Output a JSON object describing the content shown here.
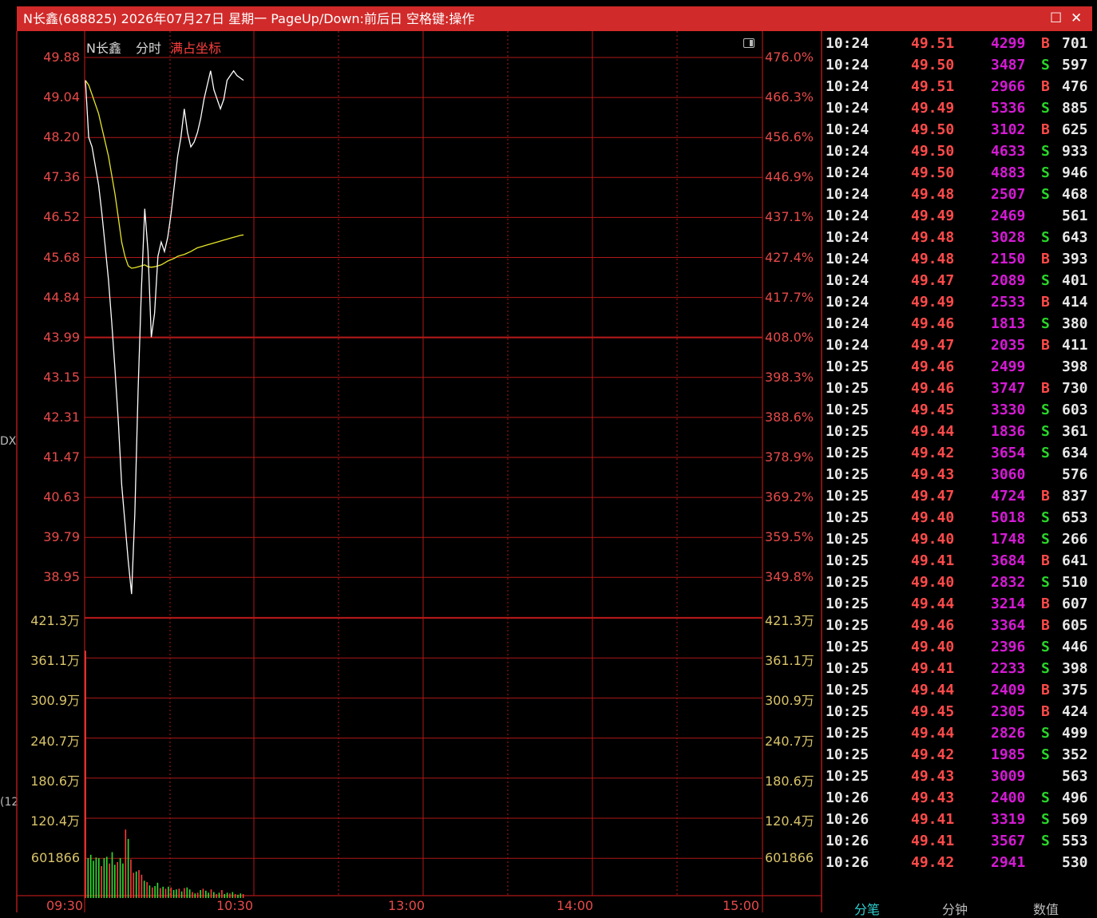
{
  "window": {
    "title": "N长鑫(688825) 2026年07月27日 星期一 PageUp/Down:前后日 空格键:操作",
    "maximize_glyph": "☐",
    "close_glyph": "✕"
  },
  "chart_header": {
    "stock_name": "N长鑫",
    "mode_label": "分时",
    "scale_label": "满占坐标"
  },
  "left_edge_labels": [
    "DX",
    "(12"
  ],
  "price_axis_left": [
    "49.88",
    "49.04",
    "48.20",
    "47.36",
    "46.52",
    "45.68",
    "44.84",
    "43.99",
    "43.15",
    "42.31",
    "41.47",
    "40.63",
    "39.79",
    "38.95"
  ],
  "pct_axis_right": [
    "476.0%",
    "466.3%",
    "456.6%",
    "446.9%",
    "437.1%",
    "427.4%",
    "417.7%",
    "408.0%",
    "398.3%",
    "388.6%",
    "378.9%",
    "369.2%",
    "359.5%",
    "349.8%"
  ],
  "volume_axis_left": [
    "421.3万",
    "361.1万",
    "300.9万",
    "240.7万",
    "180.6万",
    "120.4万",
    "601866"
  ],
  "volume_axis_right": [
    "421.3万",
    "361.1万",
    "300.9万",
    "240.7万",
    "180.6万",
    "120.4万",
    "601866"
  ],
  "time_axis": [
    "09:30",
    "10:30",
    "13:00",
    "14:00",
    "15:00"
  ],
  "colors": {
    "grid": "#b01818",
    "price_line": "#ffffff",
    "avg_line": "#e6e62a",
    "vol_up": "#ff3b3b",
    "vol_down": "#2ee02e",
    "title_bg": "#d12a2a"
  },
  "chart_data": {
    "type": "line",
    "ylim": [
      38.95,
      49.88
    ],
    "series": [
      {
        "values": [
          49.4,
          48.2,
          48.0,
          47.6,
          47.2,
          46.6,
          45.9,
          45.2,
          44.3,
          43.3,
          42.2,
          40.9,
          40.1,
          39.3,
          38.6,
          40.3,
          42.9,
          45.0,
          46.7,
          45.8,
          44.0,
          44.5,
          45.7,
          46.0,
          45.8,
          46.1,
          46.6,
          47.2,
          47.8,
          48.2,
          48.8,
          48.3,
          48.0,
          48.1,
          48.3,
          48.6,
          49.0,
          49.3,
          49.6,
          49.2,
          49.0,
          48.8,
          49.0,
          49.4,
          49.5,
          49.6,
          49.5,
          49.45,
          49.4
        ]
      },
      {
        "values": [
          49.4,
          49.3,
          49.1,
          48.9,
          48.7,
          48.4,
          48.1,
          47.8,
          47.4,
          47.0,
          46.5,
          46.0,
          45.7,
          45.5,
          45.45,
          45.46,
          45.48,
          45.5,
          45.52,
          45.48,
          45.47,
          45.48,
          45.5,
          45.52,
          45.56,
          45.6,
          45.63,
          45.66,
          45.7,
          45.72,
          45.74,
          45.77,
          45.8,
          45.84,
          45.88,
          45.9,
          45.92,
          45.94,
          45.96,
          45.98,
          46.0,
          46.02,
          46.04,
          46.06,
          46.08,
          46.1,
          46.12,
          46.14,
          46.15
        ]
      }
    ],
    "volume": {
      "ylim": [
        0,
        4213000
      ],
      "values": [
        3720000,
        600000,
        650000,
        560000,
        610000,
        600000,
        480000,
        600000,
        620000,
        520000,
        690000,
        500000,
        540000,
        600000,
        520000,
        1030000,
        890000,
        580000,
        380000,
        400000,
        420000,
        350000,
        260000,
        240000,
        190000,
        160000,
        180000,
        230000,
        150000,
        170000,
        140000,
        170000,
        160000,
        120000,
        130000,
        140000,
        100000,
        150000,
        160000,
        130000,
        90000,
        70000,
        80000,
        120000,
        140000,
        110000,
        80000,
        130000,
        90000,
        60000,
        80000,
        120000,
        60000,
        80000,
        70000,
        90000,
        60000,
        50000,
        70000,
        60000
      ],
      "up": [
        1,
        0,
        0,
        0,
        0,
        0,
        1,
        0,
        0,
        1,
        0,
        0,
        1,
        0,
        0,
        1,
        0,
        1,
        1,
        0,
        1,
        1,
        0,
        1,
        0,
        1,
        0,
        0,
        1,
        0,
        1,
        0,
        1,
        0,
        0,
        1,
        0,
        1,
        0,
        0,
        1,
        0,
        1,
        0,
        1,
        0,
        0,
        1,
        0,
        1,
        0,
        1,
        0,
        0,
        1,
        0,
        1,
        0,
        0,
        1
      ]
    }
  },
  "ticks": [
    {
      "time": "10:24",
      "price": "49.51",
      "vol": "4299",
      "side": "B",
      "count": "701"
    },
    {
      "time": "10:24",
      "price": "49.50",
      "vol": "3487",
      "side": "S",
      "count": "597"
    },
    {
      "time": "10:24",
      "price": "49.51",
      "vol": "2966",
      "side": "B",
      "count": "476"
    },
    {
      "time": "10:24",
      "price": "49.49",
      "vol": "5336",
      "side": "S",
      "count": "885"
    },
    {
      "time": "10:24",
      "price": "49.50",
      "vol": "3102",
      "side": "B",
      "count": "625"
    },
    {
      "time": "10:24",
      "price": "49.50",
      "vol": "4633",
      "side": "S",
      "count": "933"
    },
    {
      "time": "10:24",
      "price": "49.50",
      "vol": "4883",
      "side": "S",
      "count": "946"
    },
    {
      "time": "10:24",
      "price": "49.48",
      "vol": "2507",
      "side": "S",
      "count": "468"
    },
    {
      "time": "10:24",
      "price": "49.49",
      "vol": "2469",
      "side": "",
      "count": "561"
    },
    {
      "time": "10:24",
      "price": "49.48",
      "vol": "3028",
      "side": "S",
      "count": "643"
    },
    {
      "time": "10:24",
      "price": "49.48",
      "vol": "2150",
      "side": "B",
      "count": "393"
    },
    {
      "time": "10:24",
      "price": "49.47",
      "vol": "2089",
      "side": "S",
      "count": "401"
    },
    {
      "time": "10:24",
      "price": "49.49",
      "vol": "2533",
      "side": "B",
      "count": "414"
    },
    {
      "time": "10:24",
      "price": "49.46",
      "vol": "1813",
      "side": "S",
      "count": "380"
    },
    {
      "time": "10:24",
      "price": "49.47",
      "vol": "2035",
      "side": "B",
      "count": "411"
    },
    {
      "time": "10:25",
      "price": "49.46",
      "vol": "2499",
      "side": "",
      "count": "398"
    },
    {
      "time": "10:25",
      "price": "49.46",
      "vol": "3747",
      "side": "B",
      "count": "730"
    },
    {
      "time": "10:25",
      "price": "49.45",
      "vol": "3330",
      "side": "S",
      "count": "603"
    },
    {
      "time": "10:25",
      "price": "49.44",
      "vol": "1836",
      "side": "S",
      "count": "361"
    },
    {
      "time": "10:25",
      "price": "49.42",
      "vol": "3654",
      "side": "S",
      "count": "634"
    },
    {
      "time": "10:25",
      "price": "49.43",
      "vol": "3060",
      "side": "",
      "count": "576"
    },
    {
      "time": "10:25",
      "price": "49.47",
      "vol": "4724",
      "side": "B",
      "count": "837"
    },
    {
      "time": "10:25",
      "price": "49.40",
      "vol": "5018",
      "side": "S",
      "count": "653"
    },
    {
      "time": "10:25",
      "price": "49.40",
      "vol": "1748",
      "side": "S",
      "count": "266"
    },
    {
      "time": "10:25",
      "price": "49.41",
      "vol": "3684",
      "side": "B",
      "count": "641"
    },
    {
      "time": "10:25",
      "price": "49.40",
      "vol": "2832",
      "side": "S",
      "count": "510"
    },
    {
      "time": "10:25",
      "price": "49.44",
      "vol": "3214",
      "side": "B",
      "count": "607"
    },
    {
      "time": "10:25",
      "price": "49.46",
      "vol": "3364",
      "side": "B",
      "count": "605"
    },
    {
      "time": "10:25",
      "price": "49.40",
      "vol": "2396",
      "side": "S",
      "count": "446"
    },
    {
      "time": "10:25",
      "price": "49.41",
      "vol": "2233",
      "side": "S",
      "count": "398"
    },
    {
      "time": "10:25",
      "price": "49.44",
      "vol": "2409",
      "side": "B",
      "count": "375"
    },
    {
      "time": "10:25",
      "price": "49.45",
      "vol": "2305",
      "side": "B",
      "count": "424"
    },
    {
      "time": "10:25",
      "price": "49.44",
      "vol": "2826",
      "side": "S",
      "count": "499"
    },
    {
      "time": "10:25",
      "price": "49.42",
      "vol": "1985",
      "side": "S",
      "count": "352"
    },
    {
      "time": "10:25",
      "price": "49.43",
      "vol": "3009",
      "side": "",
      "count": "563"
    },
    {
      "time": "10:26",
      "price": "49.43",
      "vol": "2400",
      "side": "S",
      "count": "496"
    },
    {
      "time": "10:26",
      "price": "49.41",
      "vol": "3319",
      "side": "S",
      "count": "569"
    },
    {
      "time": "10:26",
      "price": "49.41",
      "vol": "3567",
      "side": "S",
      "count": "553"
    },
    {
      "time": "10:26",
      "price": "49.42",
      "vol": "2941",
      "side": "",
      "count": "530"
    }
  ],
  "tabs": [
    "分笔",
    "分钟",
    "数值"
  ]
}
